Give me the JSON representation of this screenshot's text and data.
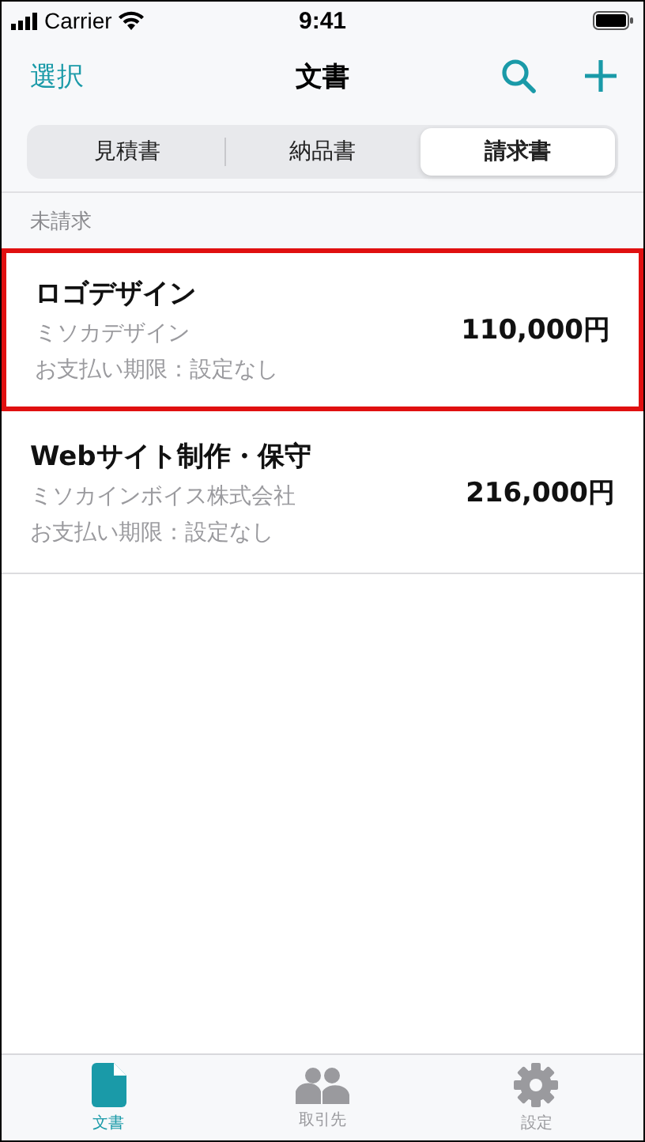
{
  "status_bar": {
    "carrier": "Carrier",
    "time": "9:41"
  },
  "nav": {
    "left": "選択",
    "title": "文書"
  },
  "segments": [
    {
      "label": "見積書",
      "selected": false
    },
    {
      "label": "納品書",
      "selected": false
    },
    {
      "label": "請求書",
      "selected": true
    }
  ],
  "section": {
    "header": "未請求",
    "rows": [
      {
        "title": "ロゴデザイン",
        "client": "ミソカデザイン",
        "due": "お支払い期限：設定なし",
        "amount": "110,000円",
        "highlighted": true
      },
      {
        "title": "Webサイト制作・保守",
        "client": "ミソカインボイス株式会社",
        "due": "お支払い期限：設定なし",
        "amount": "216,000円",
        "highlighted": false
      }
    ]
  },
  "tab_bar": [
    {
      "kind": "document",
      "label": "文書",
      "selected": true
    },
    {
      "kind": "people",
      "label": "取引先",
      "selected": false
    },
    {
      "kind": "gear",
      "label": "設定",
      "selected": false
    }
  ]
}
